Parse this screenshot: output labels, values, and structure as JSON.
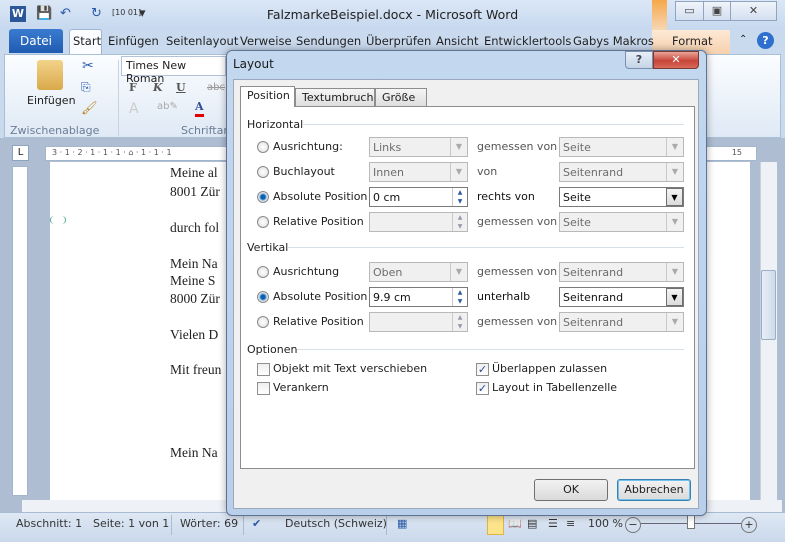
{
  "window": {
    "title": "FalzmarkeBeispiel.docx  -  Microsoft Word",
    "min": "▭",
    "max": "▣",
    "close": "✕"
  },
  "quick_access": {
    "word_icon": "W",
    "save": "💾",
    "undo": "↶",
    "redo": "↻",
    "binary": "[10 01]",
    "customize": "▾"
  },
  "ribbon_tabs": {
    "file": "Datei",
    "items": [
      "Start",
      "Einfügen",
      "Seitenlayout",
      "Verweise",
      "Sendungen",
      "Überprüfen",
      "Ansicht",
      "Entwicklertools",
      "Gabys Makros",
      "Format"
    ]
  },
  "ribbon": {
    "paste": "Einfügen",
    "clipboard_group": "Zwischenablage",
    "font_name": "Times New Roman",
    "font_group": "Schriftart",
    "bold": "F",
    "italic": "K",
    "underline": "U",
    "strike": "abc",
    "font_color": "A"
  },
  "document": {
    "lines": [
      "Meine al",
      "8001 Zür",
      "durch fol",
      "Mein Na",
      "Meine S",
      "8000 Zür",
      "Vielen D",
      "Mit freun",
      "Mein Na"
    ],
    "ruler": "3 · 1 · 2 · 1 · 1 · 1 · ⌂ · 1 · 1 · 1",
    "ruler_right": "15"
  },
  "status": {
    "section": "Abschnitt: 1",
    "page": "Seite: 1 von 1",
    "words": "Wörter: 69",
    "language": "Deutsch (Schweiz)",
    "zoom": "100 %"
  },
  "dialog": {
    "title": "Layout",
    "help": "?",
    "close": "✕",
    "tabs": [
      "Position",
      "Textumbruch",
      "Größe"
    ],
    "active_tab": "Position",
    "horizontal": {
      "label": "Horizontal",
      "rows": [
        {
          "option": "Ausrichtung:",
          "selected": false,
          "value": "Links",
          "type": "combo",
          "enabled": false,
          "relation": "gemessen von",
          "relative_to": "Seite"
        },
        {
          "option": "Buchlayout",
          "selected": false,
          "value": "Innen",
          "type": "combo",
          "enabled": false,
          "relation": "von",
          "relative_to": "Seitenrand"
        },
        {
          "option": "Absolute Position",
          "selected": true,
          "value": "0 cm",
          "type": "spin",
          "enabled": true,
          "relation": "rechts von",
          "relative_to": "Seite"
        },
        {
          "option": "Relative Position",
          "selected": false,
          "value": "",
          "type": "spin",
          "enabled": false,
          "relation": "gemessen von",
          "relative_to": "Seite"
        }
      ]
    },
    "vertical": {
      "label": "Vertikal",
      "rows": [
        {
          "option": "Ausrichtung",
          "selected": false,
          "value": "Oben",
          "type": "combo",
          "enabled": false,
          "relation": "gemessen von",
          "relative_to": "Seitenrand"
        },
        {
          "option": "Absolute Position",
          "selected": true,
          "value": "9.9 cm",
          "type": "spin",
          "enabled": true,
          "relation": "unterhalb",
          "relative_to": "Seitenrand"
        },
        {
          "option": "Relative Position",
          "selected": false,
          "value": "",
          "type": "spin",
          "enabled": false,
          "relation": "gemessen von",
          "relative_to": "Seitenrand"
        }
      ]
    },
    "options": {
      "label": "Optionen",
      "items": [
        {
          "label": "Objekt mit Text verschieben",
          "checked": false
        },
        {
          "label": "Verankern",
          "checked": false
        },
        {
          "label": "Überlappen zulassen",
          "checked": true
        },
        {
          "label": "Layout in Tabellenzelle",
          "checked": true
        }
      ]
    },
    "ok": "OK",
    "cancel": "Abbrechen"
  }
}
